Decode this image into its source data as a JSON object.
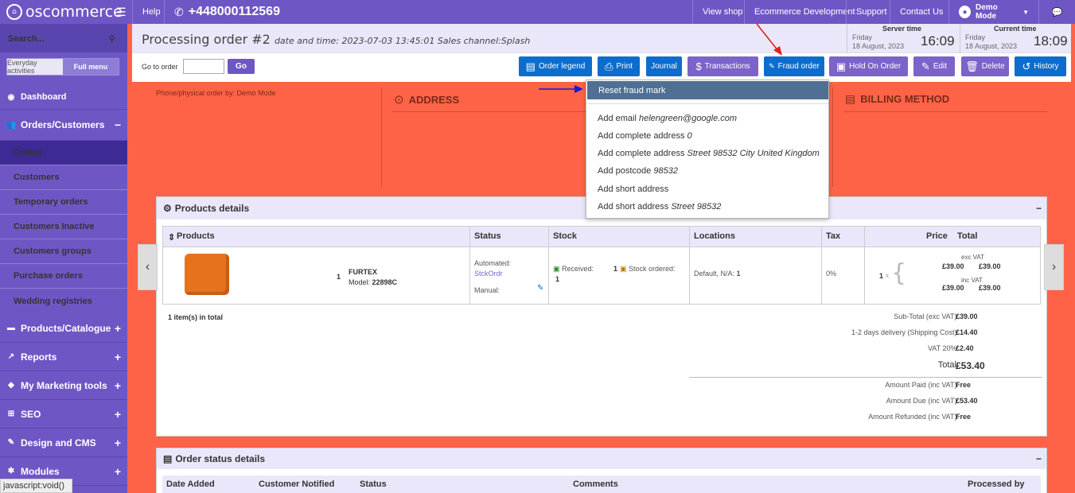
{
  "topbar": {
    "logo": "oscommerce",
    "help": "Help",
    "phone": "+448000112569",
    "view_shop": "View shop",
    "ecom_dev": "Ecommerce Development",
    "support": "Support",
    "contact": "Contact Us",
    "user": "Demo Mode"
  },
  "sidebar": {
    "search_label": "Search...",
    "tab_everyday": "Everyday activities",
    "tab_full": "Full menu",
    "dashboard": "Dashboard",
    "orders_customers": "Orders/Customers",
    "sub": [
      "Orders",
      "Customers",
      "Temporary orders",
      "Customers Inactive",
      "Customers groups",
      "Purchase orders",
      "Wedding registries"
    ],
    "products": "Products/Catalogue",
    "reports": "Reports",
    "marketing": "My Marketing tools",
    "seo": "SEO",
    "design": "Design and CMS",
    "modules": "Modules"
  },
  "statusbar": "javascript:void()",
  "header": {
    "title": "Processing order #2",
    "meta": "date and time: 2023-07-03 13:45:01  Sales channel:Splash",
    "server_label": "Server time",
    "server_day": "Friday",
    "server_date": "18 August, 2023",
    "server_time": "16:09",
    "current_label": "Current time",
    "current_day": "Friday",
    "current_date": "18 August, 2023",
    "current_time": "18:09"
  },
  "toolbar": {
    "goto_label": "Go to order",
    "go": "Go",
    "order_legend": "Order legend",
    "print": "Print",
    "journal": "Journal",
    "transactions": "Transactions",
    "fraud": "Fraud order",
    "hold": "Hold On Order",
    "edit": "Edit",
    "delete": "Delete",
    "history": "History"
  },
  "order": {
    "phone_order": "Phone/physical order by: Demo Mode",
    "address": "ADDRESS",
    "billing": "BILLING METHOD"
  },
  "products": {
    "title": "Products details",
    "cols": [
      "Products",
      "Status",
      "Stock",
      "Locations",
      "Tax",
      "Price",
      "Total"
    ],
    "qty": "1",
    "name": "FURTEX",
    "model_label": "Model:",
    "model": "22898C",
    "status_auto": "Automated:",
    "status_link": "StckOrdr",
    "status_manual": "Manual:",
    "received": "Received:",
    "received_qty": "1",
    "stock_ordered_qty": "1",
    "stock_ordered": "Stock ordered:",
    "location": "Default, N/A:",
    "location_qty": "1",
    "tax": "0%",
    "price_qty": "1",
    "price_x": "x",
    "exc_vat": "exc VAT",
    "inc_vat": "inc VAT",
    "price1": "£39.00",
    "price2": "£39.00",
    "price3": "£39.00",
    "price4": "£39.00",
    "in_total": "1 item(s) in total"
  },
  "totals": [
    {
      "label": "Sub-Total (exc VAT):",
      "value": "£39.00"
    },
    {
      "label": "1-2 days delivery  (Shipping Cost):",
      "value": "£14.40"
    },
    {
      "label": "VAT 20%:",
      "value": "£2.40"
    },
    {
      "label": "Total:",
      "value": "£53.40"
    },
    {
      "label": "Amount Paid (inc VAT):",
      "value": "Free"
    },
    {
      "label": "Amount Due (inc VAT):",
      "value": "£53.40"
    },
    {
      "label": "Amount Refunded (inc VAT):",
      "value": "Free"
    }
  ],
  "status_details": {
    "title": "Order status details",
    "cols": [
      "Date Added",
      "Customer Notified",
      "Status",
      "Comments",
      "Processed by"
    ]
  },
  "dropdown": {
    "reset": "Reset fraud mark",
    "items": [
      {
        "prefix": "Add email",
        "val": "helengreen@google.com"
      },
      {
        "prefix": "Add complete address",
        "val": "0"
      },
      {
        "prefix": "Add complete address",
        "val": "Street 98532 City United Kingdom"
      },
      {
        "prefix": "Add postcode",
        "val": "98532"
      },
      {
        "prefix": "Add short address",
        "val": ""
      },
      {
        "prefix": "Add short address",
        "val": "Street 98532"
      }
    ]
  },
  "colors": {
    "accent": "#6e57c4",
    "brand_blue": "#0c6dcd",
    "background": "#ff6347",
    "arrow_red": "#e0201c",
    "arrow_blue": "#1a1acc"
  }
}
